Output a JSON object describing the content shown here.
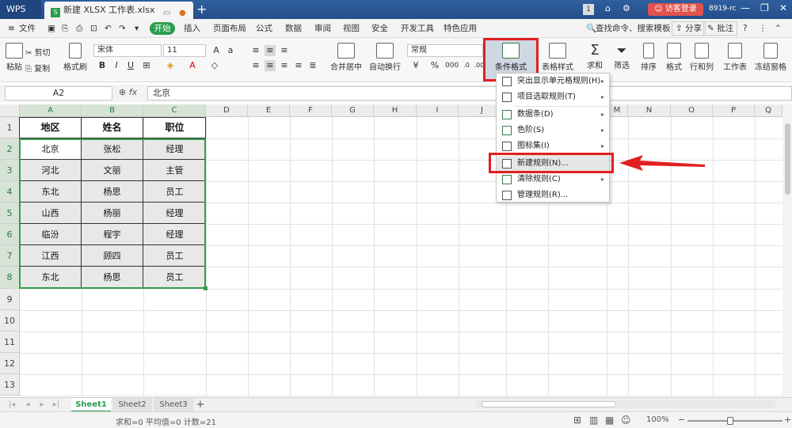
{
  "titlebar": {
    "app_name": "WPS",
    "doc_tab_title": "新建 XLSX 工作表.xlsx",
    "new_tab": "+",
    "badge": "1",
    "visitor_login": "访客登录",
    "user_id": "8919-rc"
  },
  "menubar": {
    "file": "文件",
    "kaishi": "开始",
    "tabs": [
      "插入",
      "页面布局",
      "公式",
      "数据",
      "审阅",
      "视图",
      "安全",
      "开发工具",
      "特色应用"
    ],
    "search": "查找命令、搜索模板",
    "share": "分享",
    "annotate": "批注"
  },
  "ribbon": {
    "cut": "剪切",
    "copy": "复制",
    "format_painter": "格式刷",
    "paste": "粘贴",
    "font_name": "宋体",
    "font_size": "11",
    "merge_center": "合并居中",
    "wrap_text": "自动换行",
    "number_format": "常规",
    "conditional_format": "条件格式",
    "table_style": "表格样式",
    "sum": "求和",
    "filter": "筛选",
    "sort": "排序",
    "format": "格式",
    "row_col": "行和列",
    "worksheet": "工作表",
    "freeze": "冻结窗格"
  },
  "formula_bar": {
    "name_box": "A2",
    "fx": "fx",
    "value": "北京"
  },
  "grid": {
    "columns": [
      "A",
      "B",
      "C",
      "D",
      "E",
      "F",
      "G",
      "H",
      "I",
      "J",
      "K",
      "L",
      "M",
      "N",
      "O",
      "P",
      "Q"
    ],
    "rows": [
      "1",
      "2",
      "3",
      "4",
      "5",
      "6",
      "7",
      "8",
      "9",
      "10",
      "11",
      "12",
      "13"
    ],
    "header": [
      "地区",
      "姓名",
      "职位"
    ],
    "data": [
      [
        "北京",
        "张松",
        "经理"
      ],
      [
        "河北",
        "文丽",
        "主管"
      ],
      [
        "东北",
        "杨思",
        "员工"
      ],
      [
        "山西",
        "杨丽",
        "经理"
      ],
      [
        "临汾",
        "程宇",
        "经理"
      ],
      [
        "江西",
        "顾四",
        "员工"
      ],
      [
        "东北",
        "杨思",
        "员工"
      ]
    ]
  },
  "dropdown": {
    "items": [
      {
        "label": "突出显示单元格规则(H)",
        "submenu": true
      },
      {
        "label": "项目选取规则(T)",
        "submenu": true
      },
      {
        "label": "数据条(D)",
        "submenu": true
      },
      {
        "label": "色阶(S)",
        "submenu": true
      },
      {
        "label": "图标集(I)",
        "submenu": true
      },
      {
        "label": "新建规则(N)...",
        "submenu": false
      },
      {
        "label": "清除规则(C)",
        "submenu": true
      },
      {
        "label": "管理规则(R)...",
        "submenu": false
      }
    ]
  },
  "sheets": [
    "Sheet1",
    "Sheet2",
    "Sheet3"
  ],
  "add_sheet": "+",
  "status": {
    "summary": "求和=0  平均值=0  计数=21",
    "zoom": "100%"
  },
  "colors": {
    "accent_green": "#2a9d4e",
    "highlight_red": "#e02020",
    "title_blue": "#2b579a"
  }
}
